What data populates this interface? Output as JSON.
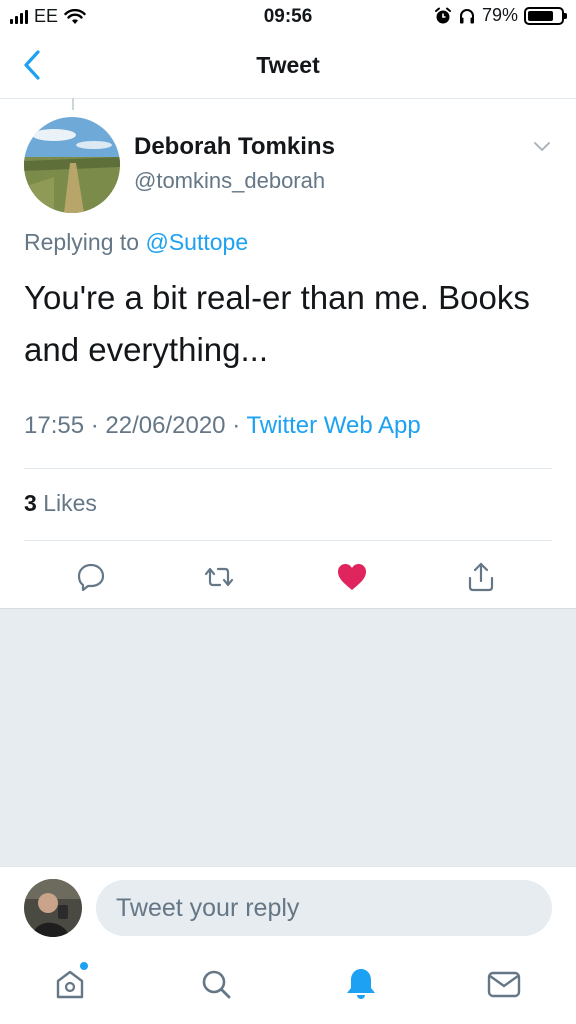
{
  "status_bar": {
    "carrier": "EE",
    "time": "09:56",
    "battery_percent": "79%",
    "battery_level": 0.79
  },
  "nav": {
    "title": "Tweet",
    "back_icon": "chevron-left-icon"
  },
  "tweet": {
    "author_name": "Deborah Tomkins",
    "author_handle": "@tomkins_deborah",
    "replying_prefix": "Replying to",
    "replying_to": "@Suttope",
    "text": "You're a bit real-er than me. Books and everything...",
    "time": "17:55",
    "date": "22/06/2020",
    "source": "Twitter Web App",
    "like_count": "3",
    "likes_label": "Likes"
  },
  "actions": [
    "reply-icon",
    "retweet-icon",
    "heart-icon",
    "share-icon"
  ],
  "reply_box": {
    "placeholder": "Tweet your reply"
  },
  "tabs": [
    "home-icon",
    "search-icon",
    "notifications-icon",
    "messages-icon"
  ],
  "colors": {
    "accent": "#1da1f2",
    "like": "#e0245e",
    "muted": "#657786",
    "background_gray": "#e6ecf0"
  }
}
